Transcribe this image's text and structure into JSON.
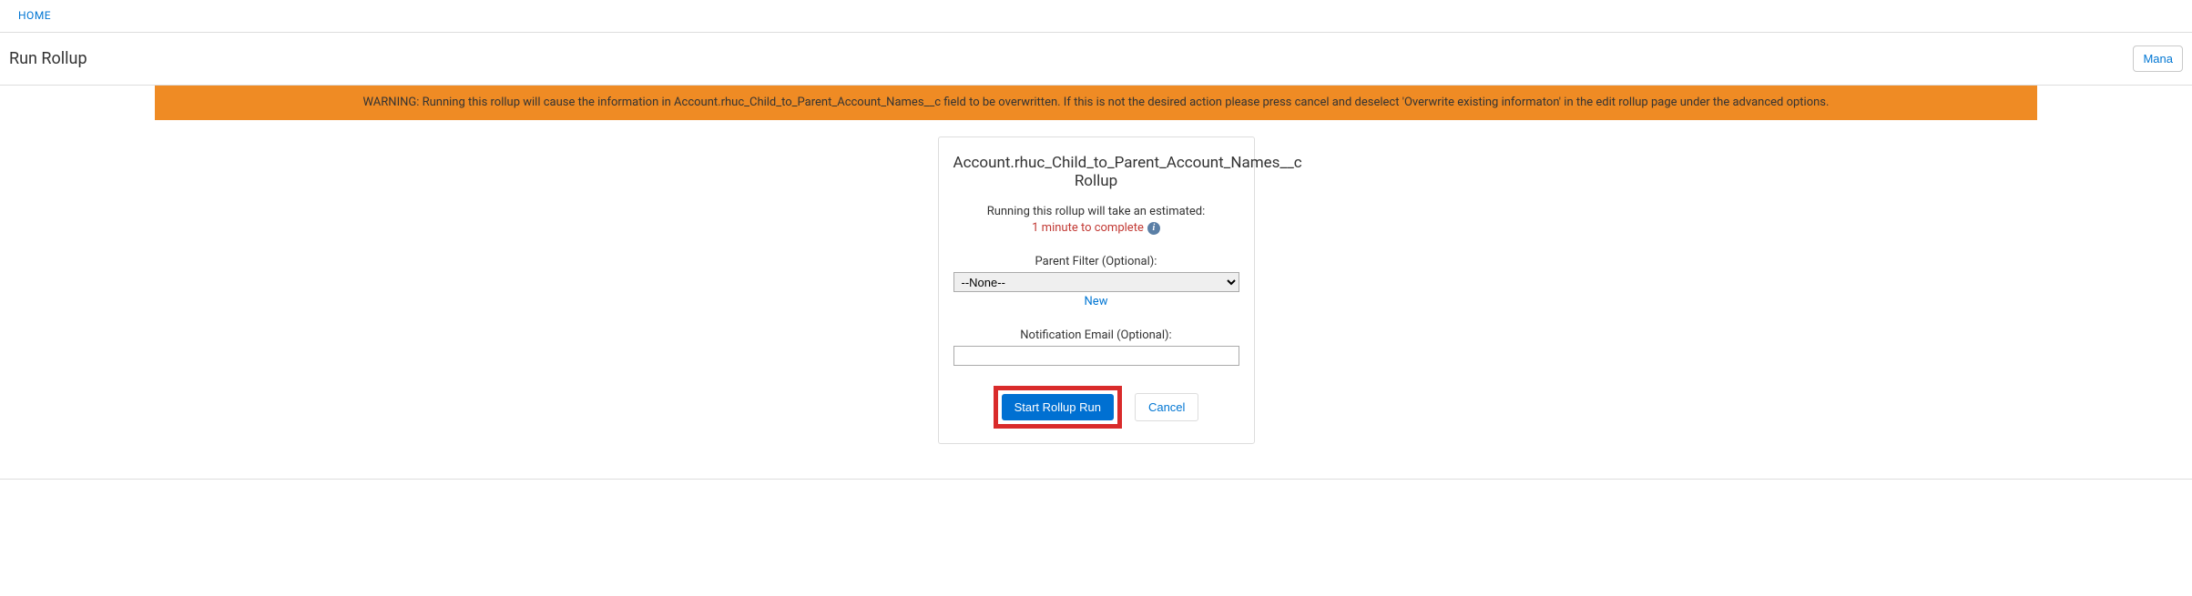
{
  "nav": {
    "home_label": "HOME"
  },
  "header": {
    "title": "Run Rollup",
    "manage_label": "Mana"
  },
  "warning": {
    "text": "WARNING: Running this rollup will cause the information in Account.rhuc_Child_to_Parent_Account_Names__c field to be overwritten. If this is not the desired action please press cancel and deselect 'Overwrite existing informaton' in the edit rollup page under the advanced options."
  },
  "card": {
    "title": "Account.rhuc_Child_to_Parent_Account_Names__c Rollup",
    "estimate_label": "Running this rollup will take an estimated:",
    "estimate_time": "1 minute to complete",
    "parent_filter_label": "Parent Filter (Optional):",
    "parent_filter_value": "--None--",
    "new_link_label": "New",
    "notification_email_label": "Notification Email (Optional):",
    "notification_email_value": "",
    "start_button_label": "Start Rollup Run",
    "cancel_button_label": "Cancel"
  }
}
